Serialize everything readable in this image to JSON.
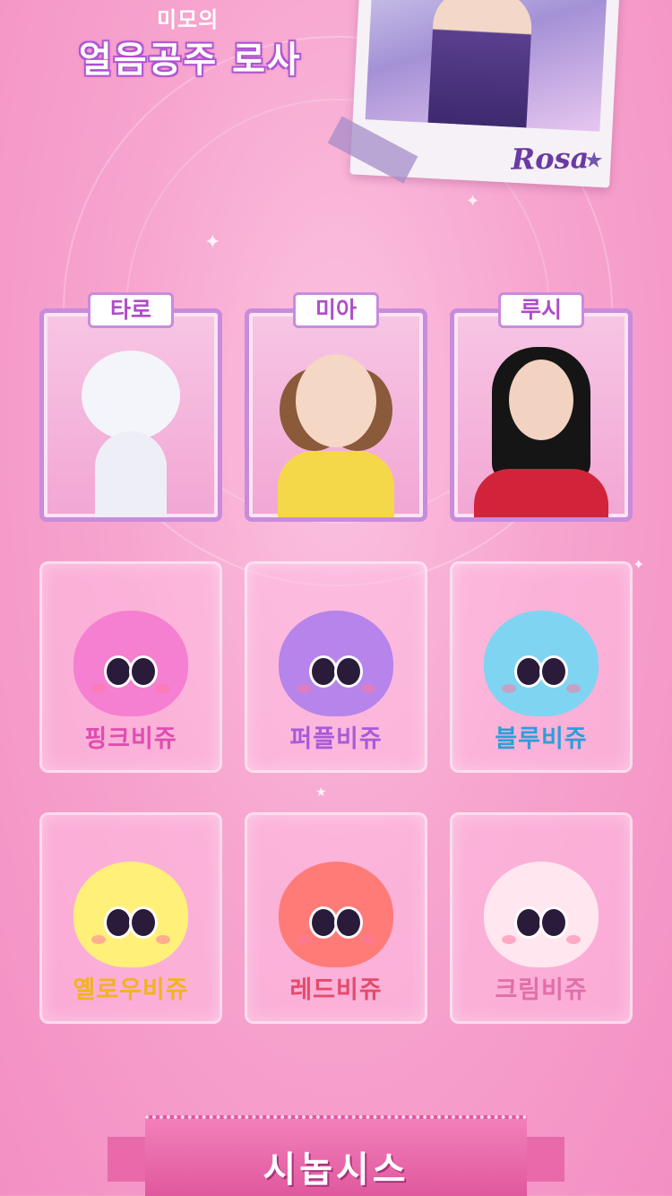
{
  "header": {
    "subtitle": "미모의",
    "title": "얼음공주 로사"
  },
  "polaroid": {
    "signature": "Rosa"
  },
  "characters": [
    {
      "name": "타로"
    },
    {
      "name": "미아"
    },
    {
      "name": "루시"
    }
  ],
  "bijous": [
    {
      "name": "핑크비쥬",
      "color": "#f57fd1",
      "label_color": "#e14cb1"
    },
    {
      "name": "퍼플비쥬",
      "color": "#b684ea",
      "label_color": "#a95ad9"
    },
    {
      "name": "블루비쥬",
      "color": "#7fd4f2",
      "label_color": "#2e9ed8"
    },
    {
      "name": "옐로우비쥬",
      "color": "#fff07a",
      "label_color": "#f0b41e"
    },
    {
      "name": "레드비쥬",
      "color": "#ff7b78",
      "label_color": "#e64a6a"
    },
    {
      "name": "크림비쥬",
      "color": "#ffe6ef",
      "label_color": "#e06fa8"
    }
  ],
  "synopsis": {
    "label": "시놉시스"
  }
}
